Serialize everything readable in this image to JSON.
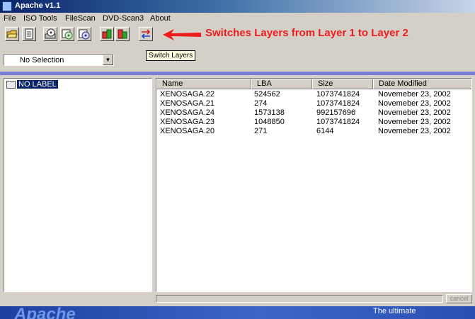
{
  "window": {
    "title": "Apache v1.1"
  },
  "menu": [
    "File",
    "ISO Tools",
    "FileScan",
    "DVD-Scan3",
    "About"
  ],
  "toolbar": {
    "buttons": [
      {
        "icon": "open-folder-icon"
      },
      {
        "icon": "document-icon"
      },
      {
        "icon": "drive-scan-icon"
      },
      {
        "icon": "disc-scan-icon"
      },
      {
        "icon": "disc-extract-icon"
      },
      {
        "icon": "layer-left-icon"
      },
      {
        "icon": "layer-right-icon"
      },
      {
        "icon": "switch-layers-icon"
      }
    ],
    "tooltip": "Switch Layers"
  },
  "annotation": {
    "text": "Switches Layers from Layer 1 to Layer 2",
    "color": "#ee1c1c"
  },
  "selector": {
    "value": "No Selection"
  },
  "tree": {
    "root_label": "NO LABEL"
  },
  "file_list": {
    "columns": [
      "Name",
      "LBA",
      "Size",
      "Date Modified"
    ],
    "rows": [
      [
        "XENOSAGA.22",
        "524562",
        "1073741824",
        "Novemeber 23, 2002"
      ],
      [
        "XENOSAGA.21",
        "274",
        "1073741824",
        "Novemeber 23, 2002"
      ],
      [
        "XENOSAGA.24",
        "1573138",
        "992157696",
        "Novemeber 23, 2002"
      ],
      [
        "XENOSAGA.23",
        "1048850",
        "1073741824",
        "Novemeber 23, 2002"
      ],
      [
        "XENOSAGA.20",
        "271",
        "6144",
        "Novemeber 23, 2002"
      ]
    ]
  },
  "cancel": {
    "label": "cancel"
  },
  "banner": {
    "left_text": "Apache",
    "right_text": "The ultimate"
  },
  "colors": {
    "titlebar": "#0a246a",
    "selection": "#0a246a",
    "separator": "#7b7bd8",
    "banner": "#1e3fa0"
  }
}
